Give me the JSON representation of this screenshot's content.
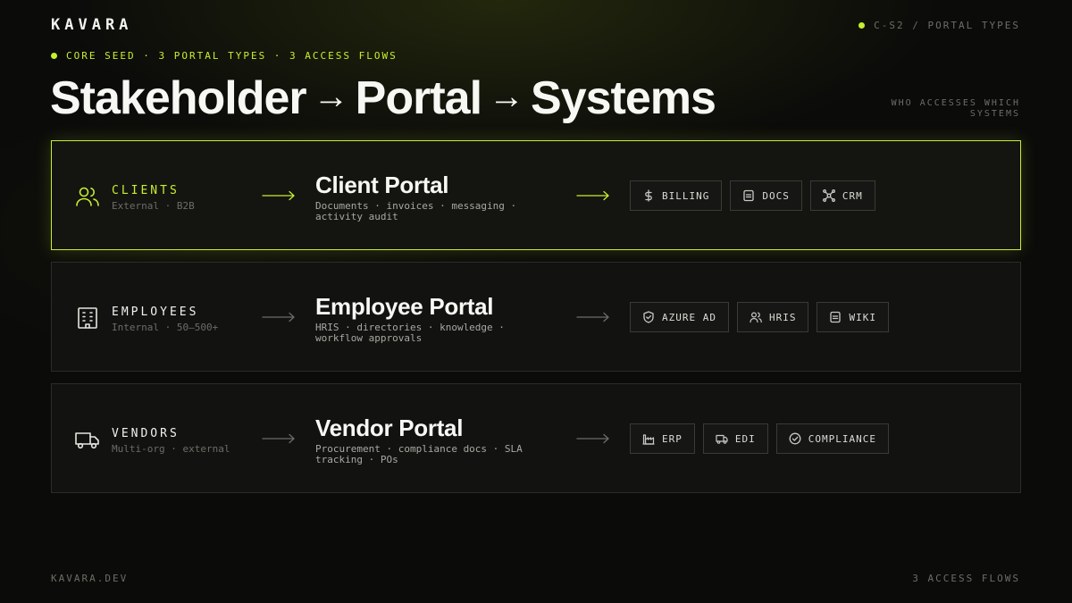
{
  "brand": "KAVARA",
  "slide_id": "C-S2 / PORTAL TYPES",
  "eyebrow": "CORE SEED · 3 PORTAL TYPES · 3 ACCESS FLOWS",
  "title": {
    "part1": "Stakeholder",
    "part2": "Portal",
    "part3": "Systems",
    "separator": "→"
  },
  "tagline": "WHO ACCESSES WHICH SYSTEMS",
  "accent_color": "#c6ef2e",
  "flows": [
    {
      "stakeholder": "CLIENTS",
      "stakeholder_sub": "External · B2B",
      "stakeholder_icon": "users-icon",
      "portal": "Client Portal",
      "portal_desc": "Documents · invoices · messaging · activity audit",
      "highlighted": true,
      "systems": [
        {
          "label": "BILLING",
          "icon": "dollar-icon"
        },
        {
          "label": "DOCS",
          "icon": "document-icon"
        },
        {
          "label": "CRM",
          "icon": "network-icon"
        }
      ]
    },
    {
      "stakeholder": "EMPLOYEES",
      "stakeholder_sub": "Internal · 50–500+",
      "stakeholder_icon": "building-icon",
      "portal": "Employee Portal",
      "portal_desc": "HRIS · directories · knowledge · workflow approvals",
      "highlighted": false,
      "systems": [
        {
          "label": "AZURE AD",
          "icon": "shield-icon"
        },
        {
          "label": "HRIS",
          "icon": "users-icon"
        },
        {
          "label": "WIKI",
          "icon": "document-icon"
        }
      ]
    },
    {
      "stakeholder": "VENDORS",
      "stakeholder_sub": "Multi-org · external",
      "stakeholder_icon": "truck-icon",
      "portal": "Vendor Portal",
      "portal_desc": "Procurement · compliance docs · SLA tracking · POs",
      "highlighted": false,
      "systems": [
        {
          "label": "ERP",
          "icon": "factory-icon"
        },
        {
          "label": "EDI",
          "icon": "truck-icon"
        },
        {
          "label": "COMPLIANCE",
          "icon": "check-circle-icon"
        }
      ]
    }
  ],
  "footer": {
    "left": "KAVARA.DEV",
    "right": "3 ACCESS FLOWS"
  }
}
